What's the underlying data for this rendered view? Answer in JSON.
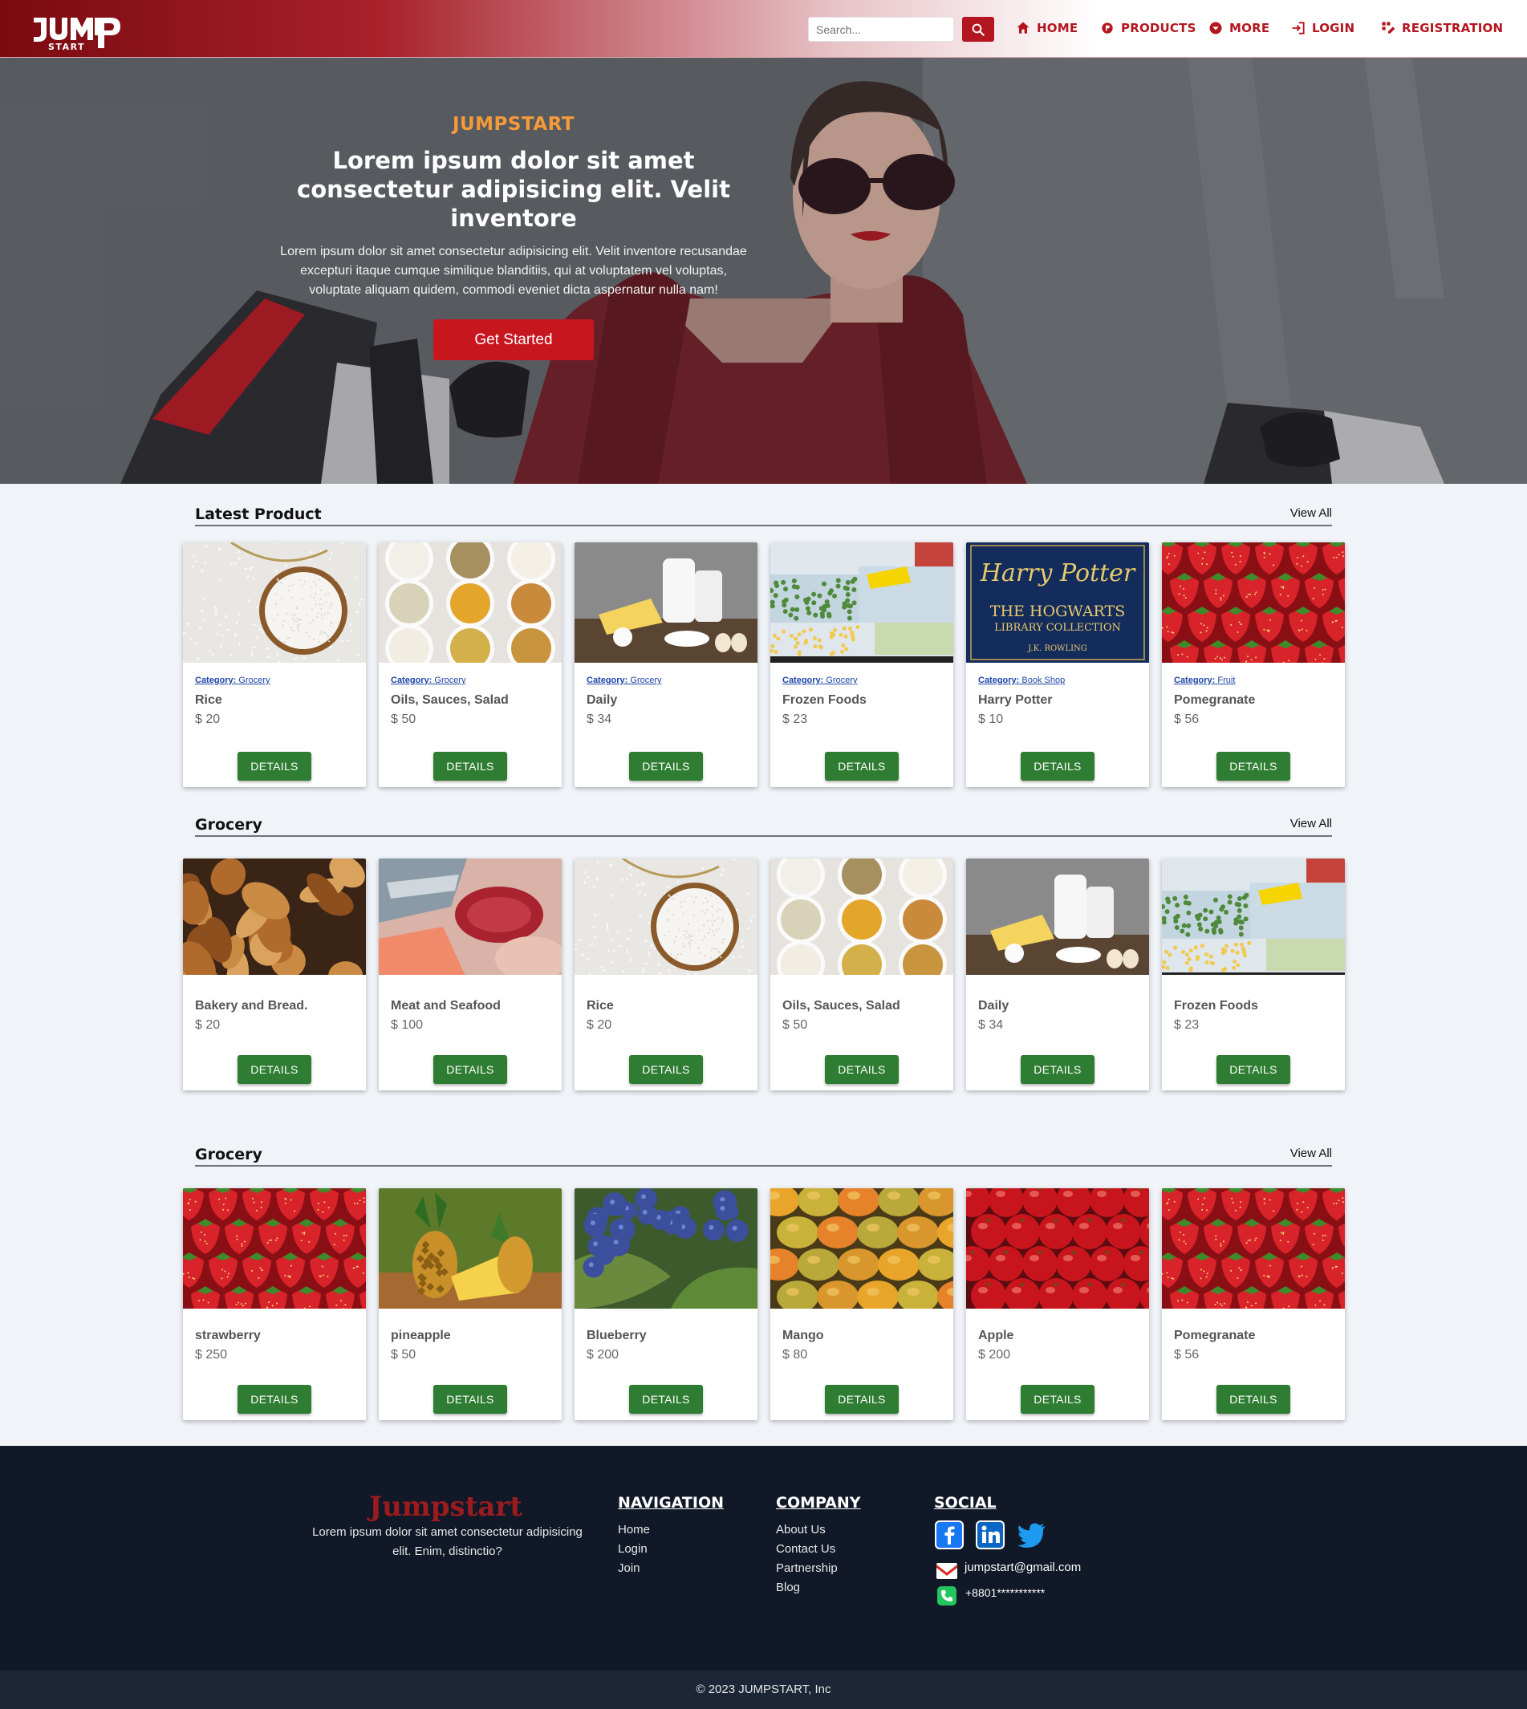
{
  "header": {
    "search_placeholder": "Search...",
    "nav": [
      {
        "label": "HOME",
        "icon": "home-icon"
      },
      {
        "label": "PRODUCTS",
        "icon": "products-icon"
      },
      {
        "label": "MORE",
        "icon": "chevron-down-icon"
      },
      {
        "label": "LOGIN",
        "icon": "login-icon"
      },
      {
        "label": "REGISTRATION",
        "icon": "registration-icon"
      }
    ],
    "logo_text": "JUMP START",
    "accent": "#b3161e"
  },
  "hero": {
    "brand": "JUMPSTART",
    "title": "Lorem ipsum dolor sit amet consectetur adipisicing elit. Velit inventore",
    "description": "Lorem ipsum dolor sit amet consectetur adipisicing elit. Velit inventore recusandae excepturi itaque cumque similique blanditiis, qui at voluptatem vel voluptas, voluptate aliquam quidem, commodi eveniet dicta aspernatur nulla nam!",
    "cta": "Get Started"
  },
  "sections": [
    {
      "title": "Latest Product",
      "view_all": "View All",
      "products": [
        {
          "category_label": "Category:",
          "category": "Grocery",
          "name": "Rice",
          "price": "$ 20",
          "image": "rice"
        },
        {
          "category_label": "Category:",
          "category": "Grocery",
          "name": "Oils, Sauces, Salad",
          "price": "$ 50",
          "image": "oils"
        },
        {
          "category_label": "Category:",
          "category": "Grocery",
          "name": "Daily",
          "price": "$ 34",
          "image": "dairy"
        },
        {
          "category_label": "Category:",
          "category": "Grocery",
          "name": "Frozen Foods",
          "price": "$ 23",
          "image": "frozen"
        },
        {
          "category_label": "Category:",
          "category": "Book Shop",
          "name": "Harry Potter",
          "price": "$ 10",
          "image": "book"
        },
        {
          "category_label": "Category:",
          "category": "Fruit",
          "name": "Pomegranate",
          "price": "$ 56",
          "image": "strawberry"
        }
      ]
    },
    {
      "title": "Grocery",
      "view_all": "View All",
      "products": [
        {
          "name": "Bakery and Bread.",
          "price": "$ 20",
          "image": "bread"
        },
        {
          "name": "Meat and Seafood",
          "price": "$ 100",
          "image": "meat"
        },
        {
          "name": "Rice",
          "price": "$ 20",
          "image": "rice"
        },
        {
          "name": "Oils, Sauces, Salad",
          "price": "$ 50",
          "image": "oils"
        },
        {
          "name": "Daily",
          "price": "$ 34",
          "image": "dairy"
        },
        {
          "name": "Frozen Foods",
          "price": "$ 23",
          "image": "frozen"
        }
      ]
    },
    {
      "title": "Grocery",
      "view_all": "View All",
      "products": [
        {
          "name": "strawberry",
          "price": "$ 250",
          "image": "strawberry"
        },
        {
          "name": "pineapple",
          "price": "$ 50",
          "image": "pineapple"
        },
        {
          "name": "Blueberry",
          "price": "$ 200",
          "image": "blueberry"
        },
        {
          "name": "Mango",
          "price": "$ 80",
          "image": "mango"
        },
        {
          "name": "Apple",
          "price": "$ 200",
          "image": "apple"
        },
        {
          "name": "Pomegranate",
          "price": "$ 56",
          "image": "strawberry"
        }
      ]
    }
  ],
  "book_cover": {
    "title": "Harry Potter",
    "subtitle_1": "THE HOGWARTS",
    "subtitle_2": "LIBRARY COLLECTION",
    "author": "J.K. ROWLING"
  },
  "details_label": "DETAILS",
  "footer": {
    "brand": "Jumpstart",
    "about": "Lorem ipsum dolor sit amet consectetur adipisicing elit. Enim, distinctio?",
    "navigation_title": "NAVIGATION",
    "navigation": [
      "Home",
      "Login",
      "Join"
    ],
    "company_title": "COMPANY",
    "company": [
      "About Us",
      "Contact Us",
      "Partnership",
      "Blog"
    ],
    "social_title": "SOCIAL",
    "email": "jumpstart@gmail.com",
    "phone": "+8801***********",
    "copyright": "© 2023 JUMPSTART, Inc"
  }
}
